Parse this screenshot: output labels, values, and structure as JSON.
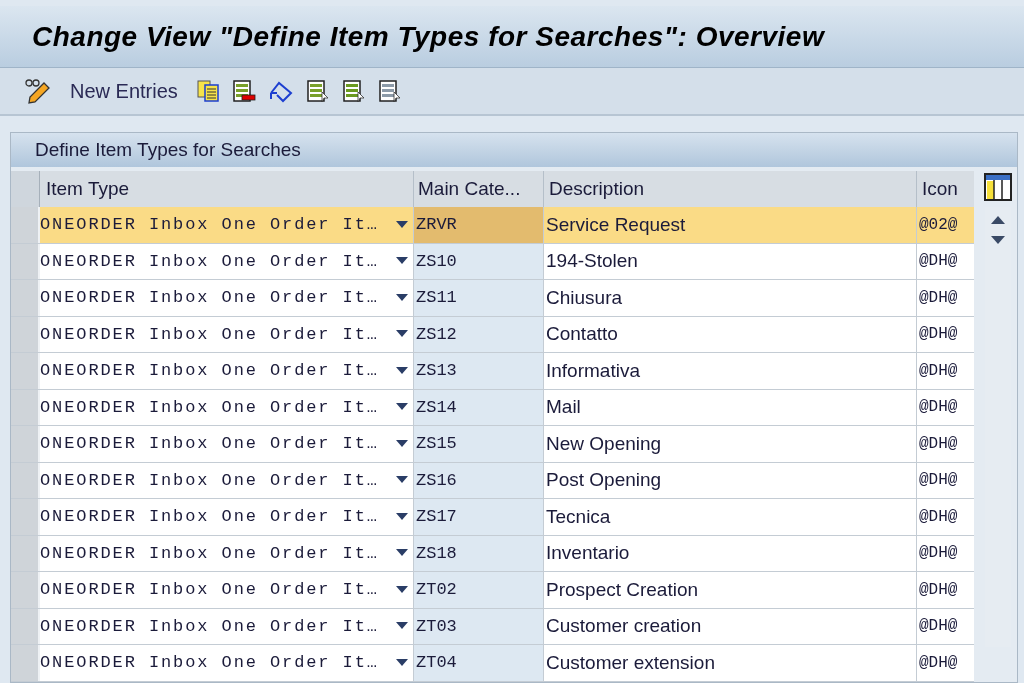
{
  "window": {
    "title": "Change View \"Define Item Types for Searches\": Overview"
  },
  "toolbar": {
    "new_entries": "New Entries"
  },
  "table": {
    "title": "Define Item Types for Searches",
    "columns": [
      "Item Type",
      "Main Cate...",
      "Description",
      "Icon"
    ],
    "rows": [
      {
        "item_type": "ONEORDER Inbox One Order It…",
        "main_category": "ZRVR",
        "description": "Service Request",
        "icon": "@02@",
        "selected": true
      },
      {
        "item_type": "ONEORDER Inbox One Order It…",
        "main_category": "ZS10",
        "description": "194-Stolen",
        "icon": "@DH@",
        "selected": false
      },
      {
        "item_type": "ONEORDER Inbox One Order It…",
        "main_category": "ZS11",
        "description": "Chiusura",
        "icon": "@DH@",
        "selected": false
      },
      {
        "item_type": "ONEORDER Inbox One Order It…",
        "main_category": "ZS12",
        "description": "Contatto",
        "icon": "@DH@",
        "selected": false
      },
      {
        "item_type": "ONEORDER Inbox One Order It…",
        "main_category": "ZS13",
        "description": "Informativa",
        "icon": "@DH@",
        "selected": false
      },
      {
        "item_type": "ONEORDER Inbox One Order It…",
        "main_category": "ZS14",
        "description": "Mail",
        "icon": "@DH@",
        "selected": false
      },
      {
        "item_type": "ONEORDER Inbox One Order It…",
        "main_category": "ZS15",
        "description": "New Opening",
        "icon": "@DH@",
        "selected": false
      },
      {
        "item_type": "ONEORDER Inbox One Order It…",
        "main_category": "ZS16",
        "description": "Post Opening",
        "icon": "@DH@",
        "selected": false
      },
      {
        "item_type": "ONEORDER Inbox One Order It…",
        "main_category": "ZS17",
        "description": "Tecnica",
        "icon": "@DH@",
        "selected": false
      },
      {
        "item_type": "ONEORDER Inbox One Order It…",
        "main_category": "ZS18",
        "description": "Inventario",
        "icon": "@DH@",
        "selected": false
      },
      {
        "item_type": "ONEORDER Inbox One Order It…",
        "main_category": "ZT02",
        "description": "Prospect Creation",
        "icon": "@DH@",
        "selected": false
      },
      {
        "item_type": "ONEORDER Inbox One Order It…",
        "main_category": "ZT03",
        "description": "Customer creation",
        "icon": "@DH@",
        "selected": false
      },
      {
        "item_type": "ONEORDER Inbox One Order It…",
        "main_category": "ZT04",
        "description": "Customer extension",
        "icon": "@DH@",
        "selected": false
      }
    ]
  }
}
